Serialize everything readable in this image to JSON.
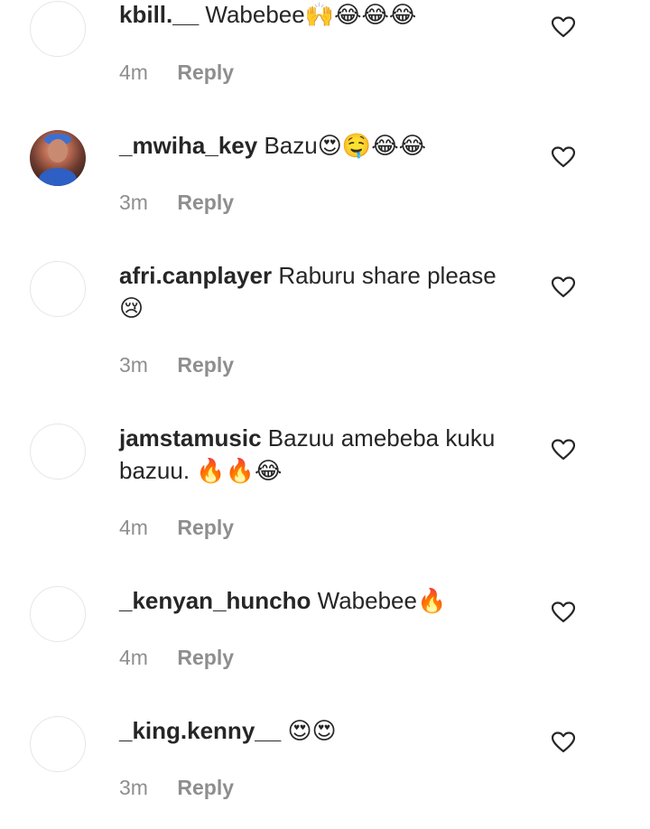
{
  "comments": [
    {
      "username": "kbill.__",
      "text": "Wabebee",
      "emoji": "🙌😂😂😂",
      "time": "4m",
      "reply": "Reply",
      "avatar": "empty"
    },
    {
      "username": "_mwiha_key",
      "text": "Bazu",
      "emoji": "😍🤤😂😂",
      "time": "3m",
      "reply": "Reply",
      "avatar": "photo"
    },
    {
      "username": "afri.canplayer",
      "text": "Raburu share please",
      "emoji": "😢",
      "time": "3m",
      "reply": "Reply",
      "avatar": "empty"
    },
    {
      "username": "jamstamusic",
      "text": "Bazuu amebeba kuku bazuu.",
      "emoji": "🔥🔥😂",
      "time": "4m",
      "reply": "Reply",
      "avatar": "empty"
    },
    {
      "username": "_kenyan_huncho",
      "text": "Wabebee",
      "emoji": "🔥",
      "time": "4m",
      "reply": "Reply",
      "avatar": "empty"
    },
    {
      "username": "_king.kenny__",
      "text": "",
      "emoji": "😍😍",
      "time": "3m",
      "reply": "Reply",
      "avatar": "empty"
    }
  ],
  "icons": {
    "like": "heart-outline-icon"
  },
  "colors": {
    "text": "#262626",
    "muted": "#8e8e8e",
    "avatar_border": "#e6e6e6"
  }
}
